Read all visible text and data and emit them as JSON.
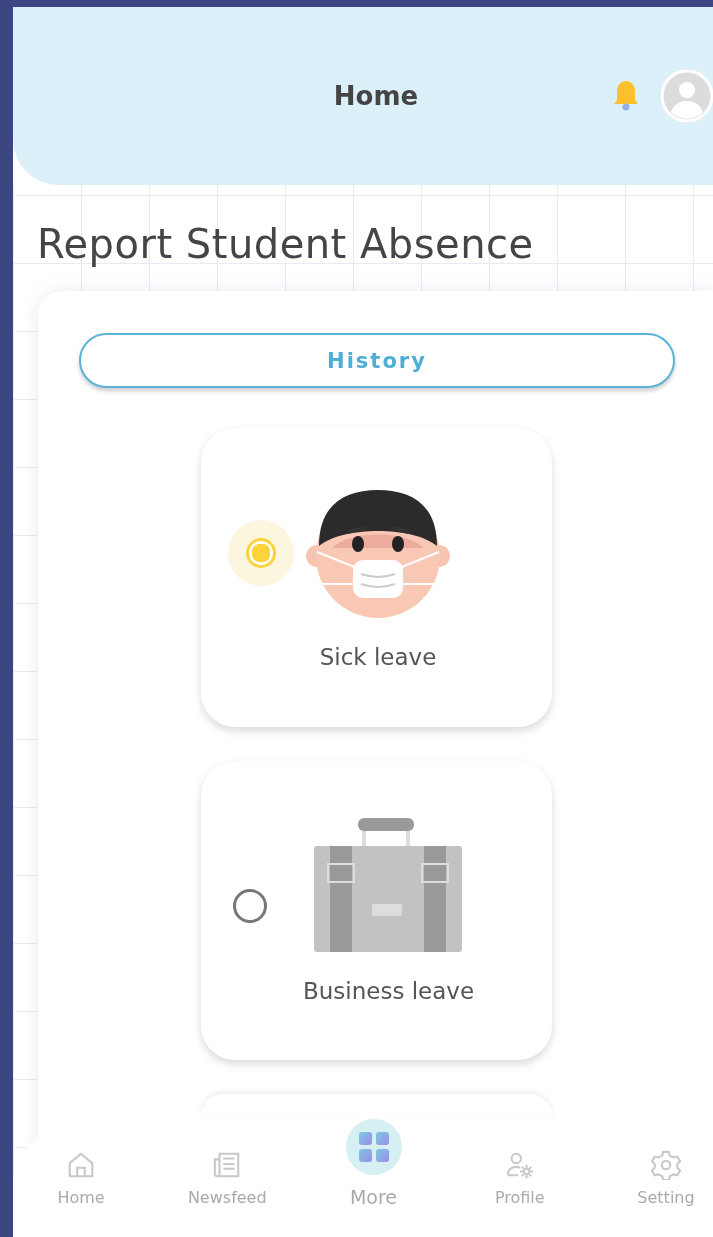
{
  "header": {
    "title": "Home"
  },
  "page_title": "Report Student Absence",
  "history_button": "History",
  "leave_options": [
    {
      "kind": "sick",
      "label": "Sick leave",
      "selected": true
    },
    {
      "kind": "business",
      "label": "Business leave",
      "selected": false
    }
  ],
  "bottom_nav": [
    {
      "kind": "home",
      "label": "Home"
    },
    {
      "kind": "newsfeed",
      "label": "Newsfeed"
    },
    {
      "kind": "more",
      "label": "More"
    },
    {
      "kind": "profile",
      "label": "Profile"
    },
    {
      "kind": "setting",
      "label": "Setting"
    }
  ]
}
